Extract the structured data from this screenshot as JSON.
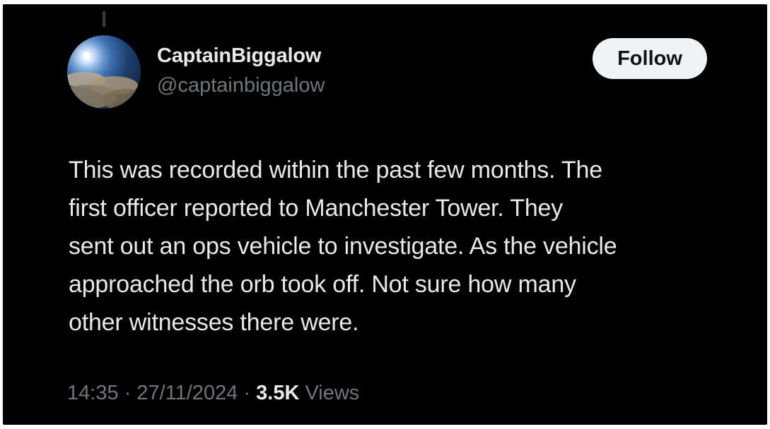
{
  "author": {
    "display_name": "CaptainBiggalow",
    "handle": "@captainbiggalow"
  },
  "follow_button": {
    "label": "Follow"
  },
  "tweet": {
    "lines": [
      "This was recorded within the past few months.  The",
      "first officer reported to Manchester Tower. They",
      "sent out an ops vehicle to investigate. As the vehicle",
      "approached the orb took off. Not sure how many",
      "other witnesses there were."
    ]
  },
  "meta": {
    "time": "14:35",
    "separator": " · ",
    "date": "27/11/2024",
    "views_count": "3.5K",
    "views_label": "Views"
  },
  "colors": {
    "background": "#000000",
    "primary_text": "#e7e9ea",
    "secondary_text": "#71767b",
    "button_bg": "#eff3f4"
  }
}
